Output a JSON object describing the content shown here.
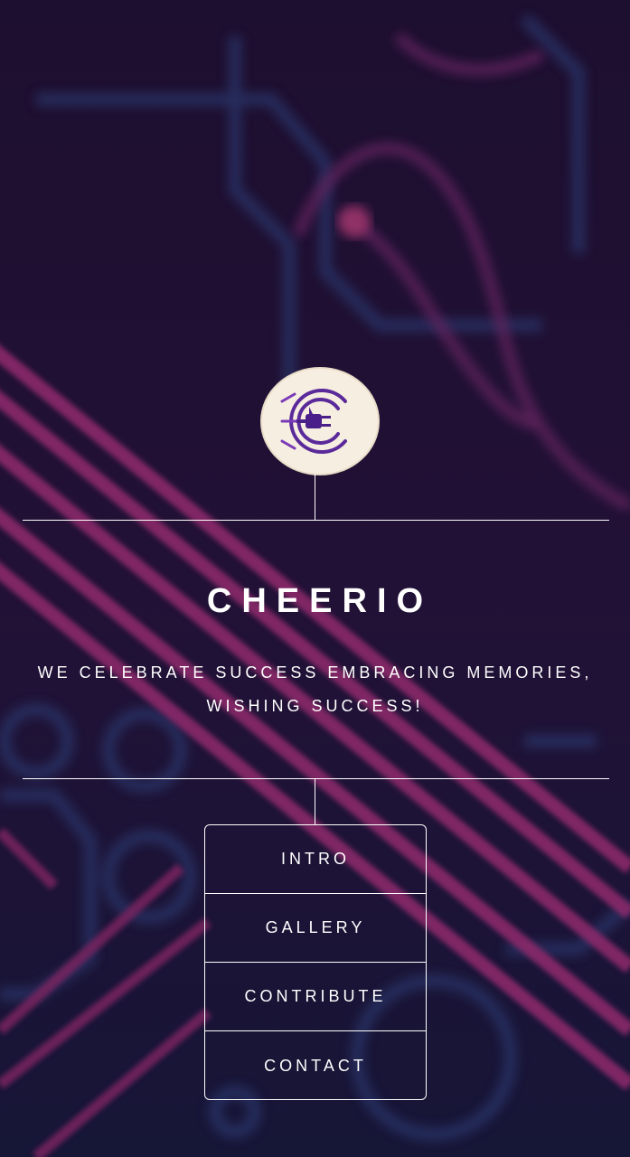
{
  "brand": {
    "title": "CHEERIO",
    "logo_icon": "plug-c-logo-icon"
  },
  "tagline": {
    "line1": "WE CELEBRATE SUCCESS EMBRACING MEMORIES,",
    "line2": "WISHING SUCCESS!"
  },
  "nav": {
    "items": [
      {
        "label": "INTRO"
      },
      {
        "label": "GALLERY"
      },
      {
        "label": "CONTRIBUTE"
      },
      {
        "label": "CONTACT"
      }
    ]
  },
  "colors": {
    "background": "#1a0f2e",
    "neon_pink": "#b0307e",
    "neon_blue": "#2a4a8a",
    "logo_bg": "#f6eee0",
    "logo_accent": "#6b2aa0"
  }
}
